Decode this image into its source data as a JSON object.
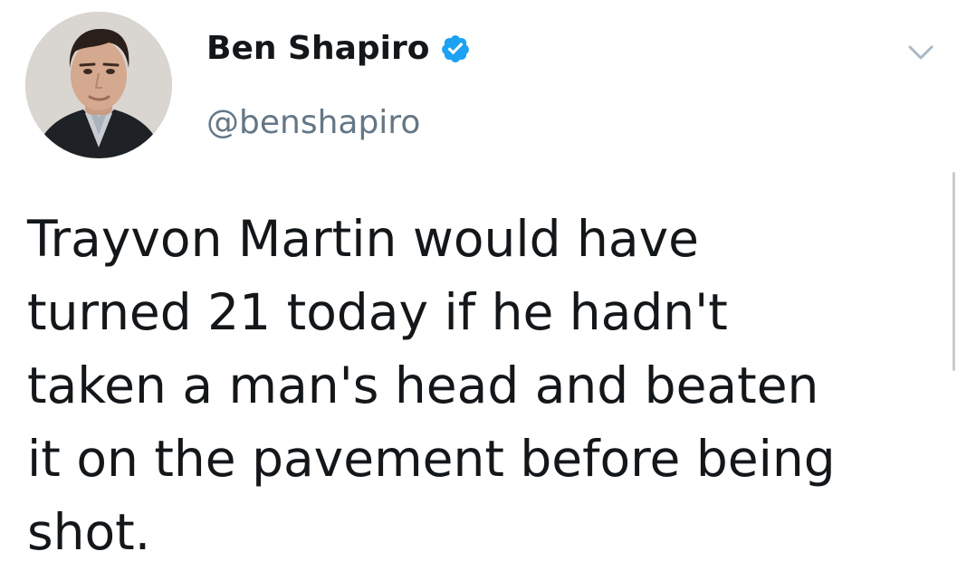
{
  "author": {
    "display_name": "Ben Shapiro",
    "handle": "@benshapiro",
    "verified_icon": "verified-badge-icon",
    "avatar": "profile-photo"
  },
  "tweet": {
    "text": "Trayvon Martin would have\nturned 21 today if he hadn't\ntaken a man's head and beaten\nit on the pavement before being\nshot."
  },
  "menu": {
    "icon": "chevron-down-icon"
  },
  "colors": {
    "text": "#14171a",
    "secondary": "#657786",
    "verified": "#1da1f2",
    "background": "#ffffff"
  }
}
